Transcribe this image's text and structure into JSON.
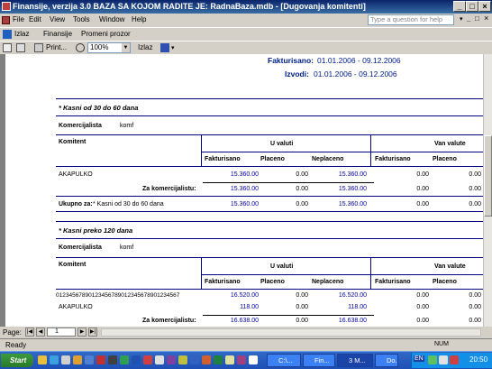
{
  "window": {
    "title": "Finansije, verzija 3.0      BAZA SA KOJOM RADITE JE: RadnaBaza.mdb - [Dugovanja komitenti]",
    "min": "_",
    "max": "□",
    "close": "×"
  },
  "menubar": {
    "items": [
      "File",
      "Edit",
      "View",
      "Tools",
      "Window",
      "Help"
    ],
    "help_placeholder": "Type a question for help",
    "doc_controls": [
      "_",
      "□",
      "×"
    ]
  },
  "toolbar1": {
    "izlaz": "Izlaz",
    "finansije": "Finansije",
    "promeni_prozor": "Promeni prozor"
  },
  "toolbar2": {
    "print": "Print...",
    "zoom": "100%",
    "izlaz": "Izlaz"
  },
  "report": {
    "fakturisano_label": "Fakturisano:",
    "fakturisano_range": "01.01.2006 - 09.12.2006",
    "izvodi_label": "Izvodi:",
    "izvodi_range": "01.01.2006 - 09.12.2006",
    "section1": {
      "title": "* Kasni od 30 do 60 dana",
      "komercijalista_label": "Komercijalista",
      "komercijalista_value": "komf",
      "komitent_label": "Komitent",
      "u_valuti": "U valuti",
      "van_valute": "Van valute",
      "cols": [
        "Fakturisano",
        "Placeno",
        "Neplaceno",
        "Fakturisano",
        "Placeno"
      ],
      "rows": [
        {
          "name": "AKAPULKO",
          "v": [
            "15.360.00",
            "0.00",
            "15.360.00",
            "0.00",
            "0.00"
          ]
        }
      ],
      "za_kom_label": "Za komercijalistu:",
      "za_kom": [
        "15.360.00",
        "0.00",
        "15.360.00",
        "0.00",
        "0.00"
      ],
      "ukupno_label": "Ukupno za:",
      "ukupno_desc": "* Kasni od 30 do 60 dana",
      "ukupno": [
        "15.360.00",
        "0.00",
        "15.360.00",
        "0.00",
        "0.00"
      ]
    },
    "section2": {
      "title": "* Kasni preko 120 dana",
      "komercijalista_label": "Komercijalista",
      "komercijalista_value": "komf",
      "komitent_label": "Komitent",
      "u_valuti": "U valuti",
      "van_valute": "Van valute",
      "cols": [
        "Fakturisano",
        "Placeno",
        "Neplaceno",
        "Fakturisano",
        "Placeno"
      ],
      "rows": [
        {
          "name": "01234567890123456789012345678901234567",
          "v": [
            "16.520.00",
            "0.00",
            "16.520.00",
            "0.00",
            "0.00"
          ]
        },
        {
          "name": "AKAPULKO",
          "v": [
            "118.00",
            "0.00",
            "118.00",
            "0.00",
            "0.00"
          ]
        }
      ],
      "za_kom_label": "Za komercijalistu:",
      "za_kom": [
        "16.638.00",
        "0.00",
        "16.638.00",
        "0.00",
        "0.00"
      ]
    }
  },
  "pagenav": {
    "label": "Page:",
    "page": "1"
  },
  "statusbar": {
    "status": "Ready",
    "num": "NUM"
  },
  "taskbar": {
    "start": "Start",
    "buttons": [
      "C:\\...",
      "Fin...",
      "3 M...",
      "Do..."
    ],
    "clock": "20:50",
    "lang": "EN"
  }
}
